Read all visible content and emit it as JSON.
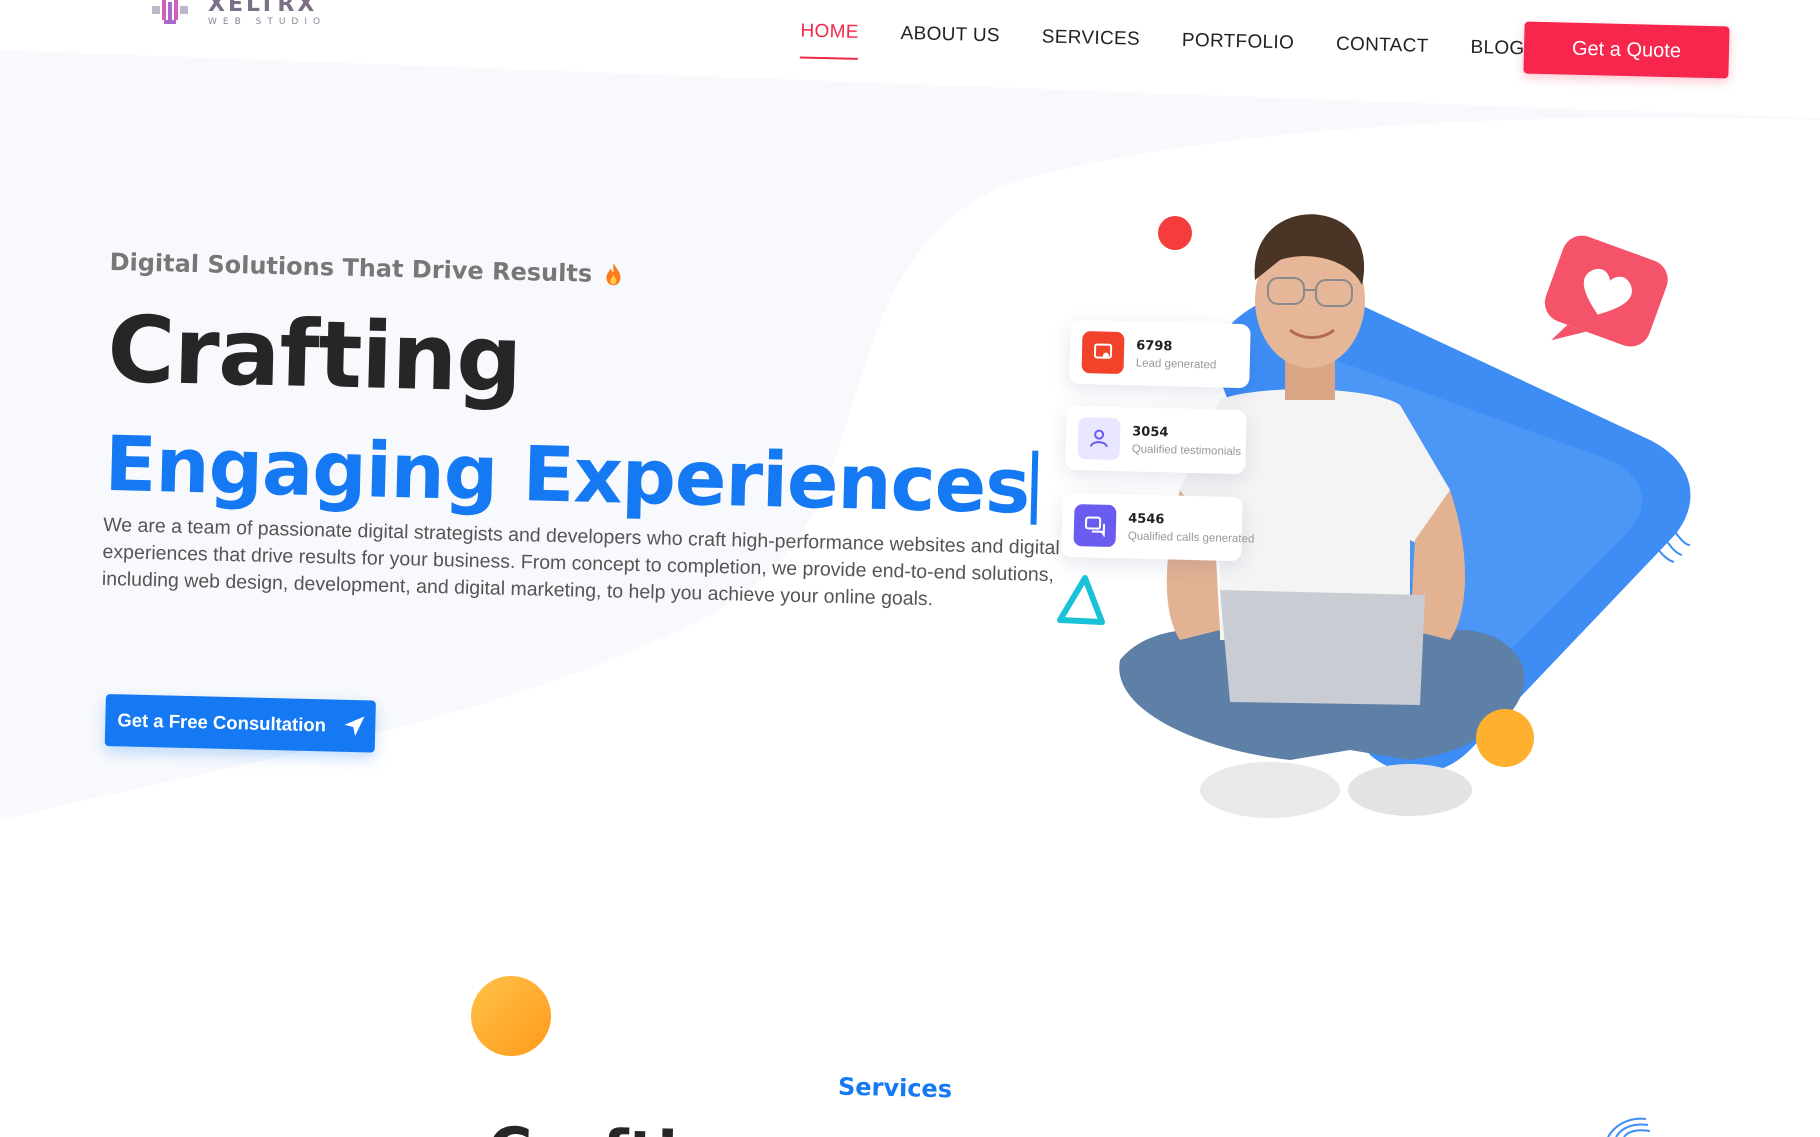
{
  "brand": {
    "name": "XELTRX",
    "subtitle": "WEB STUDIO"
  },
  "nav": {
    "items": [
      {
        "label": "HOME",
        "active": true
      },
      {
        "label": "ABOUT US",
        "active": false
      },
      {
        "label": "SERVICES",
        "active": false
      },
      {
        "label": "PORTFOLIO",
        "active": false
      },
      {
        "label": "CONTACT",
        "active": false
      },
      {
        "label": "BLOGS",
        "active": false
      }
    ],
    "quote_button": "Get a Quote"
  },
  "hero": {
    "tagline": "Digital Solutions That Drive Results",
    "headline_line1": "Crafting",
    "headline_line2": "Engaging Experiences",
    "description": "We are a team of passionate digital strategists and developers who craft high-performance websites and digital experiences that drive results for your business. From concept to completion, we provide end-to-end solutions, including web design, development, and digital marketing, to help you achieve your online goals.",
    "cta_label": "Get a Free Consultation"
  },
  "stats": [
    {
      "value": "6798",
      "label": "Lead generated",
      "icon": "lead-icon",
      "color": "#f0432a"
    },
    {
      "value": "3054",
      "label": "Qualified testimonials",
      "icon": "users-icon",
      "color": "#6a5cf0"
    },
    {
      "value": "4546",
      "label": "Qualified calls generated",
      "icon": "chat-icon",
      "color": "#6a5cf0"
    }
  ],
  "services": {
    "label": "Services",
    "title": "Crafting"
  },
  "colors": {
    "accent_red": "#f6264d",
    "accent_blue": "#1479f2",
    "heading_dark": "#262626",
    "orange_ball": "#ffb02e"
  }
}
